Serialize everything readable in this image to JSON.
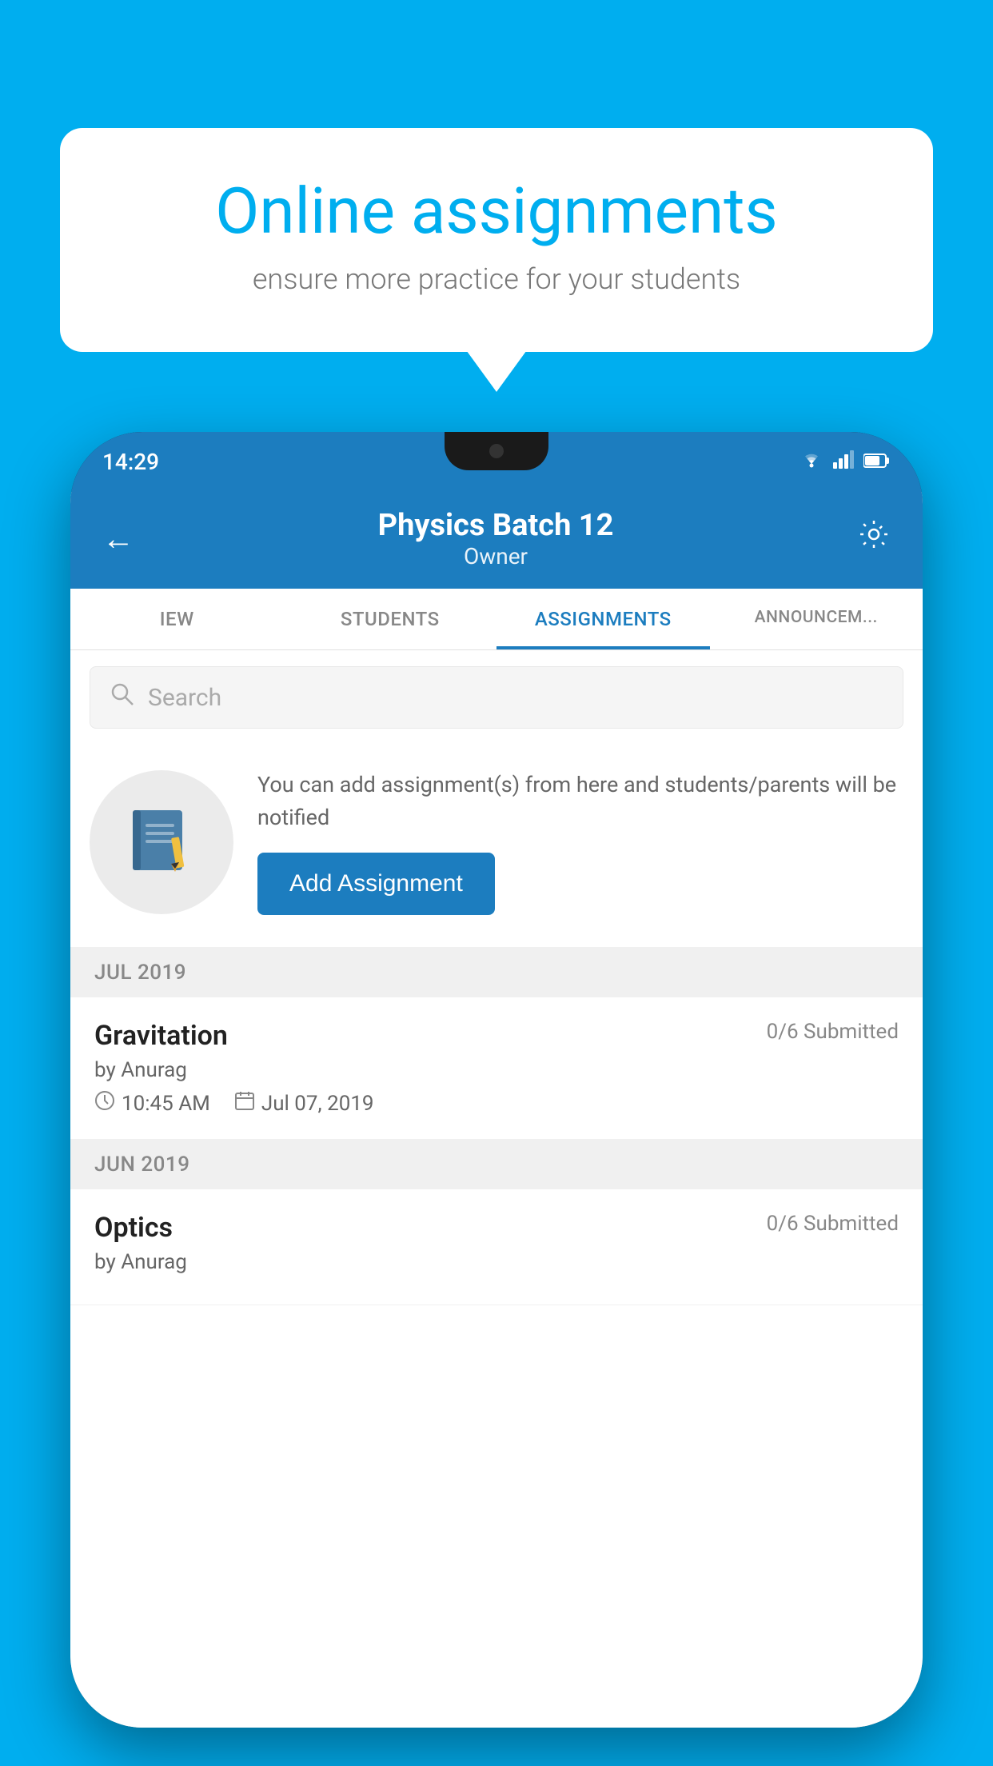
{
  "background_color": "#00AEEF",
  "speech_bubble": {
    "title": "Online assignments",
    "subtitle": "ensure more practice for your students"
  },
  "phone": {
    "status_bar": {
      "time": "14:29",
      "icons": [
        "wifi",
        "signal",
        "battery"
      ]
    },
    "header": {
      "title": "Physics Batch 12",
      "subtitle": "Owner",
      "back_label": "←",
      "settings_label": "⚙"
    },
    "tabs": [
      {
        "label": "IEW",
        "active": false
      },
      {
        "label": "STUDENTS",
        "active": false
      },
      {
        "label": "ASSIGNMENTS",
        "active": true
      },
      {
        "label": "ANNOUNCEM...",
        "active": false
      }
    ],
    "search": {
      "placeholder": "Search"
    },
    "add_assignment": {
      "description": "You can add assignment(s) from here and students/parents will be notified",
      "button_label": "Add Assignment"
    },
    "sections": [
      {
        "month": "JUL 2019",
        "assignments": [
          {
            "title": "Gravitation",
            "submitted": "0/6 Submitted",
            "by": "by Anurag",
            "time": "10:45 AM",
            "date": "Jul 07, 2019"
          }
        ]
      },
      {
        "month": "JUN 2019",
        "assignments": [
          {
            "title": "Optics",
            "submitted": "0/6 Submitted",
            "by": "by Anurag",
            "time": "",
            "date": ""
          }
        ]
      }
    ]
  }
}
